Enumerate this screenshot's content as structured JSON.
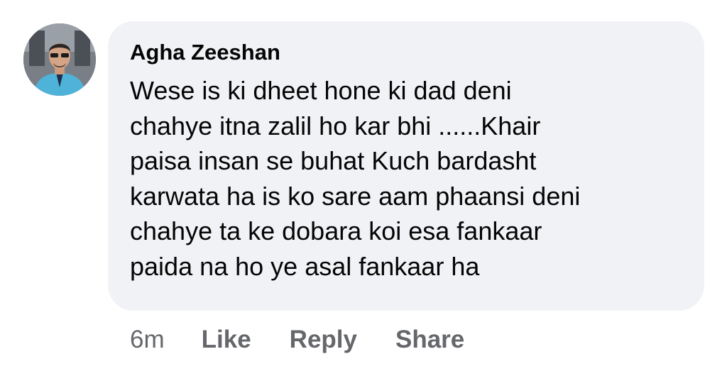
{
  "comment": {
    "author": "Agha Zeeshan",
    "text_lines": [
      "Wese is ki dheet hone ki dad deni",
      "chahye itna zalil ho kar bhi ......Khair",
      "paisa insan se buhat Kuch bardasht",
      "karwata ha is ko sare aam phaansi deni",
      "chahye ta ke dobara koi esa fankaar",
      "paida na ho ye asal fankaar ha"
    ],
    "timestamp": "6m",
    "actions": {
      "like": "Like",
      "reply": "Reply",
      "share": "Share"
    }
  },
  "colors": {
    "bubble_background": "#f0f2f5",
    "primary_text": "#050505",
    "secondary_text": "#65676b"
  },
  "icons": {
    "avatar": "profile-photo-avatar"
  }
}
